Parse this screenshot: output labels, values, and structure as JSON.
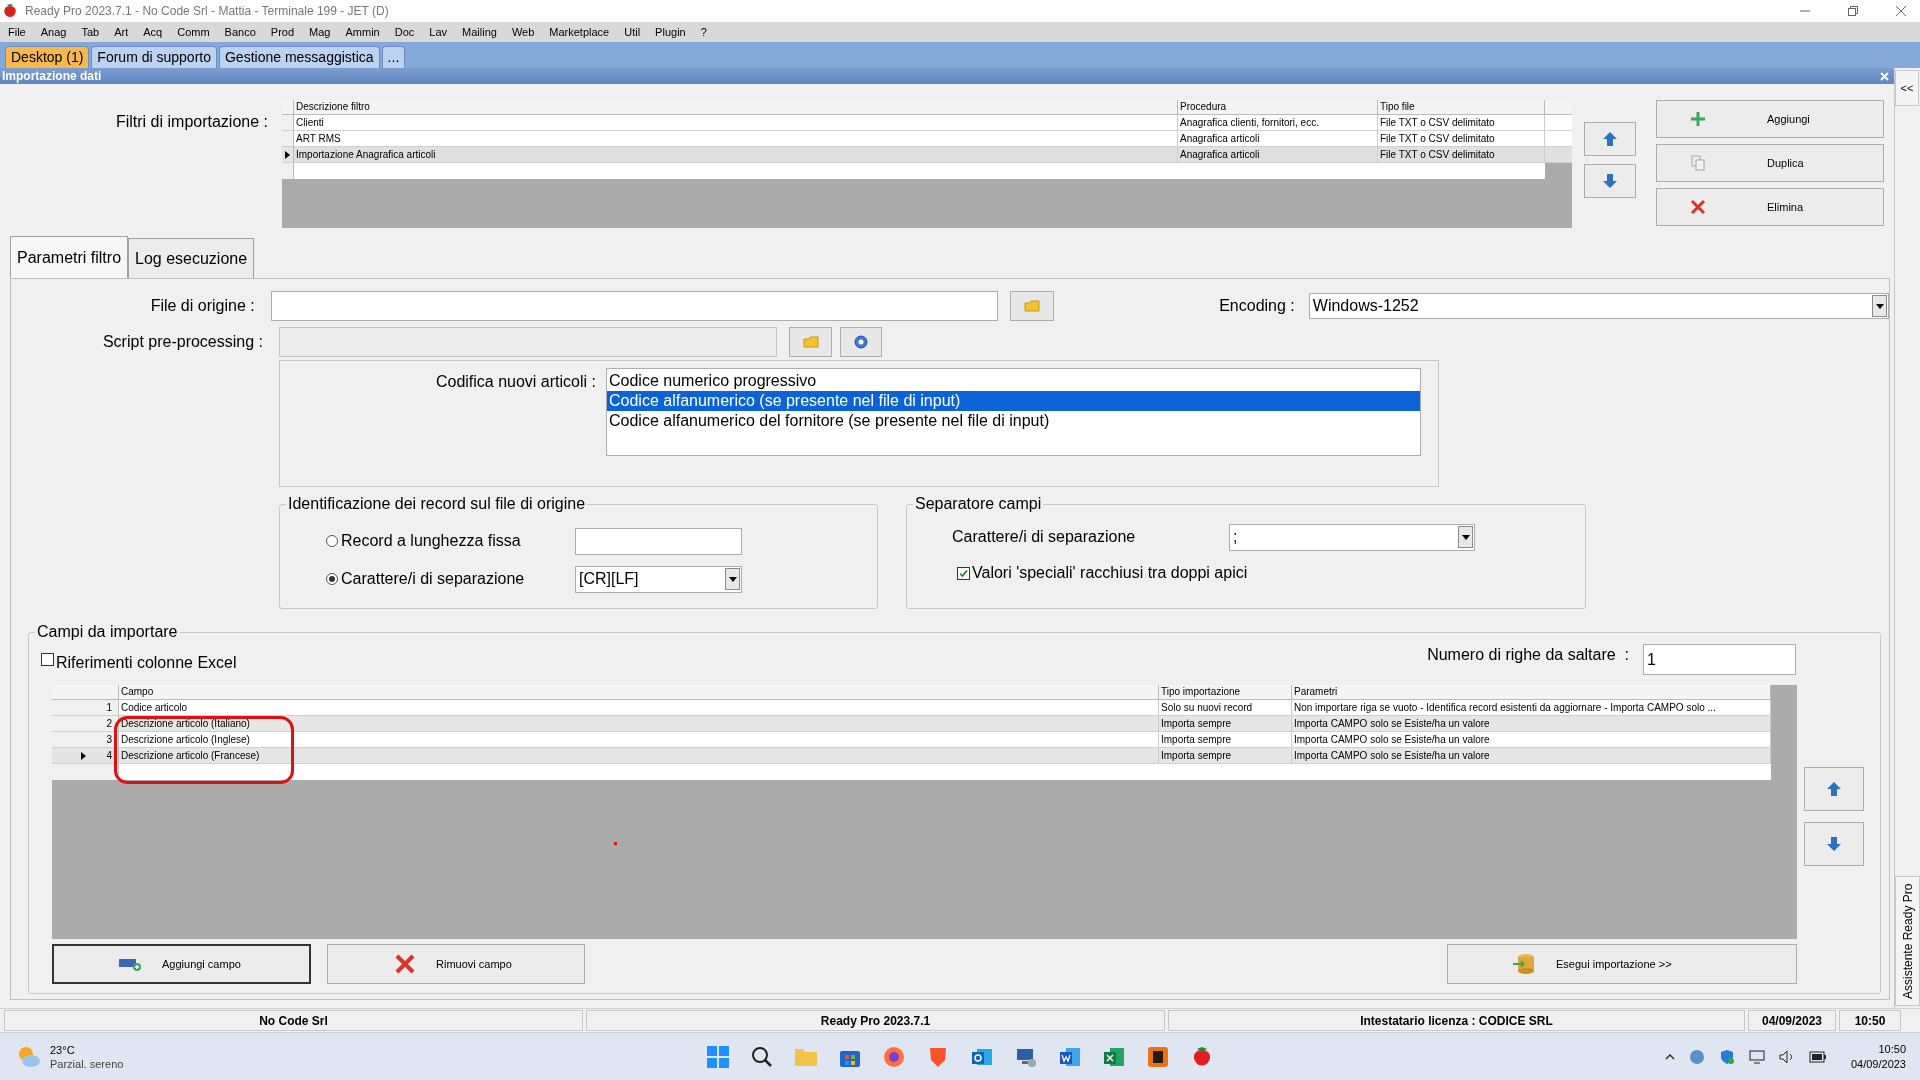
{
  "window": {
    "title": "Ready Pro 2023.7.1 - No Code Srl - Mattia - Terminale 199 - JET (D)"
  },
  "menu": [
    "File",
    "Anag",
    "Tab",
    "Art",
    "Acq",
    "Comm",
    "Banco",
    "Prod",
    "Mag",
    "Ammin",
    "Doc",
    "Lav",
    "Mailing",
    "Web",
    "Marketplace",
    "Util",
    "Plugin",
    "?"
  ],
  "doc_tabs": [
    {
      "label": "Desktop (1)",
      "selected": true
    },
    {
      "label": "Forum di supporto",
      "selected": false
    },
    {
      "label": "Gestione messaggistica",
      "selected": false
    },
    {
      "label": "...",
      "selected": false
    }
  ],
  "panel": {
    "title": "Importazione dati"
  },
  "filters": {
    "label": "Filtri di importazione :",
    "columns": [
      "Descrizione filtro",
      "Procedura",
      "Tipo file"
    ],
    "rows": [
      {
        "cells": [
          "Clienti",
          "Anagrafica clienti, fornitori, ecc.",
          "File TXT o CSV delimitato"
        ],
        "selected": false
      },
      {
        "cells": [
          "ART RMS",
          "Anagrafica articoli",
          "File TXT o CSV delimitato"
        ],
        "selected": false
      },
      {
        "cells": [
          "Importazione Anagrafica articoli",
          "Anagrafica articoli",
          "File TXT o CSV delimitato"
        ],
        "selected": true
      }
    ]
  },
  "filter_buttons": [
    {
      "label": "Aggiungi",
      "kind": "add"
    },
    {
      "label": "Duplica",
      "kind": "copy"
    },
    {
      "label": "Elimina",
      "kind": "delete"
    }
  ],
  "tabs": [
    {
      "label": "Parametri filtro",
      "selected": true
    },
    {
      "label": "Log esecuzione",
      "selected": false
    }
  ],
  "file_origin": {
    "label": "File di origine :"
  },
  "encoding": {
    "label": "Encoding :",
    "value": "Windows-1252"
  },
  "script": {
    "label": "Script pre-processing :",
    "disabled": true
  },
  "codifica": {
    "label": "Codifica nuovi articoli :",
    "options": [
      {
        "label": "Codice numerico progressivo",
        "selected": false
      },
      {
        "label": "Codice alfanumerico (se presente nel file di input)",
        "selected": true
      },
      {
        "label": "Codice alfanumerico del fornitore (se presente nel file di input)",
        "selected": false
      }
    ]
  },
  "identificazione": {
    "title": "Identificazione dei record sul file di origine",
    "options": [
      {
        "label": "Record a lunghezza fissa",
        "selected": false,
        "kind": "text"
      },
      {
        "label": "Carattere/i di separazione",
        "selected": true,
        "kind": "select",
        "value": "[CR][LF]"
      }
    ]
  },
  "separatore": {
    "title": "Separatore campi",
    "label": "Carattere/i di separazione",
    "value": ";",
    "quotes": {
      "label": "Valori 'speciali' racchiusi tra doppi apici",
      "checked": true
    }
  },
  "campi": {
    "title": "Campi da importare",
    "excel": {
      "label": "Riferimenti colonne Excel",
      "checked": false
    },
    "skip": {
      "label": "Numero di righe da saltare  :",
      "value": "1"
    },
    "columns": [
      "Campo",
      "Tipo importazione",
      "Parametri"
    ],
    "rows": [
      {
        "num": "1",
        "cells": [
          "Codice articolo",
          "Solo su nuovi record",
          "Non importare riga se vuoto - Identifica record esistenti da aggiornare - Importa CAMPO solo ..."
        ],
        "selected": false
      },
      {
        "num": "2",
        "cells": [
          "Descrizione articolo (Italiano)",
          "Importa sempre",
          "Importa CAMPO solo se Esiste/ha un valore"
        ],
        "selected": false
      },
      {
        "num": "3",
        "cells": [
          "Descrizione articolo (Inglese)",
          "Importa sempre",
          "Importa CAMPO solo se Esiste/ha un valore"
        ],
        "selected": false
      },
      {
        "num": "4",
        "cells": [
          "Descrizione articolo (Francese)",
          "Importa sempre",
          "Importa CAMPO solo se Esiste/ha un valore"
        ],
        "selected": true
      }
    ]
  },
  "bottom_buttons": [
    {
      "label": "Aggiungi campo",
      "kind": "add-field",
      "focused": true
    },
    {
      "label": "Rimuovi campo",
      "kind": "remove",
      "focused": false
    },
    {
      "label": "Esegui importazione >>",
      "kind": "run",
      "focused": false
    }
  ],
  "status_bar": [
    "No Code Srl",
    "Ready Pro 2023.7.1",
    "Intestatario licenza : CODICE SRL",
    "04/09/2023",
    "10:50"
  ],
  "assistant": {
    "collapse": "<<",
    "label": "Assistente Ready Pro"
  },
  "taskbar": {
    "temperature": "23°C",
    "weather": "Parzial. sereno",
    "time": "10:50",
    "date": "04/09/2023"
  }
}
